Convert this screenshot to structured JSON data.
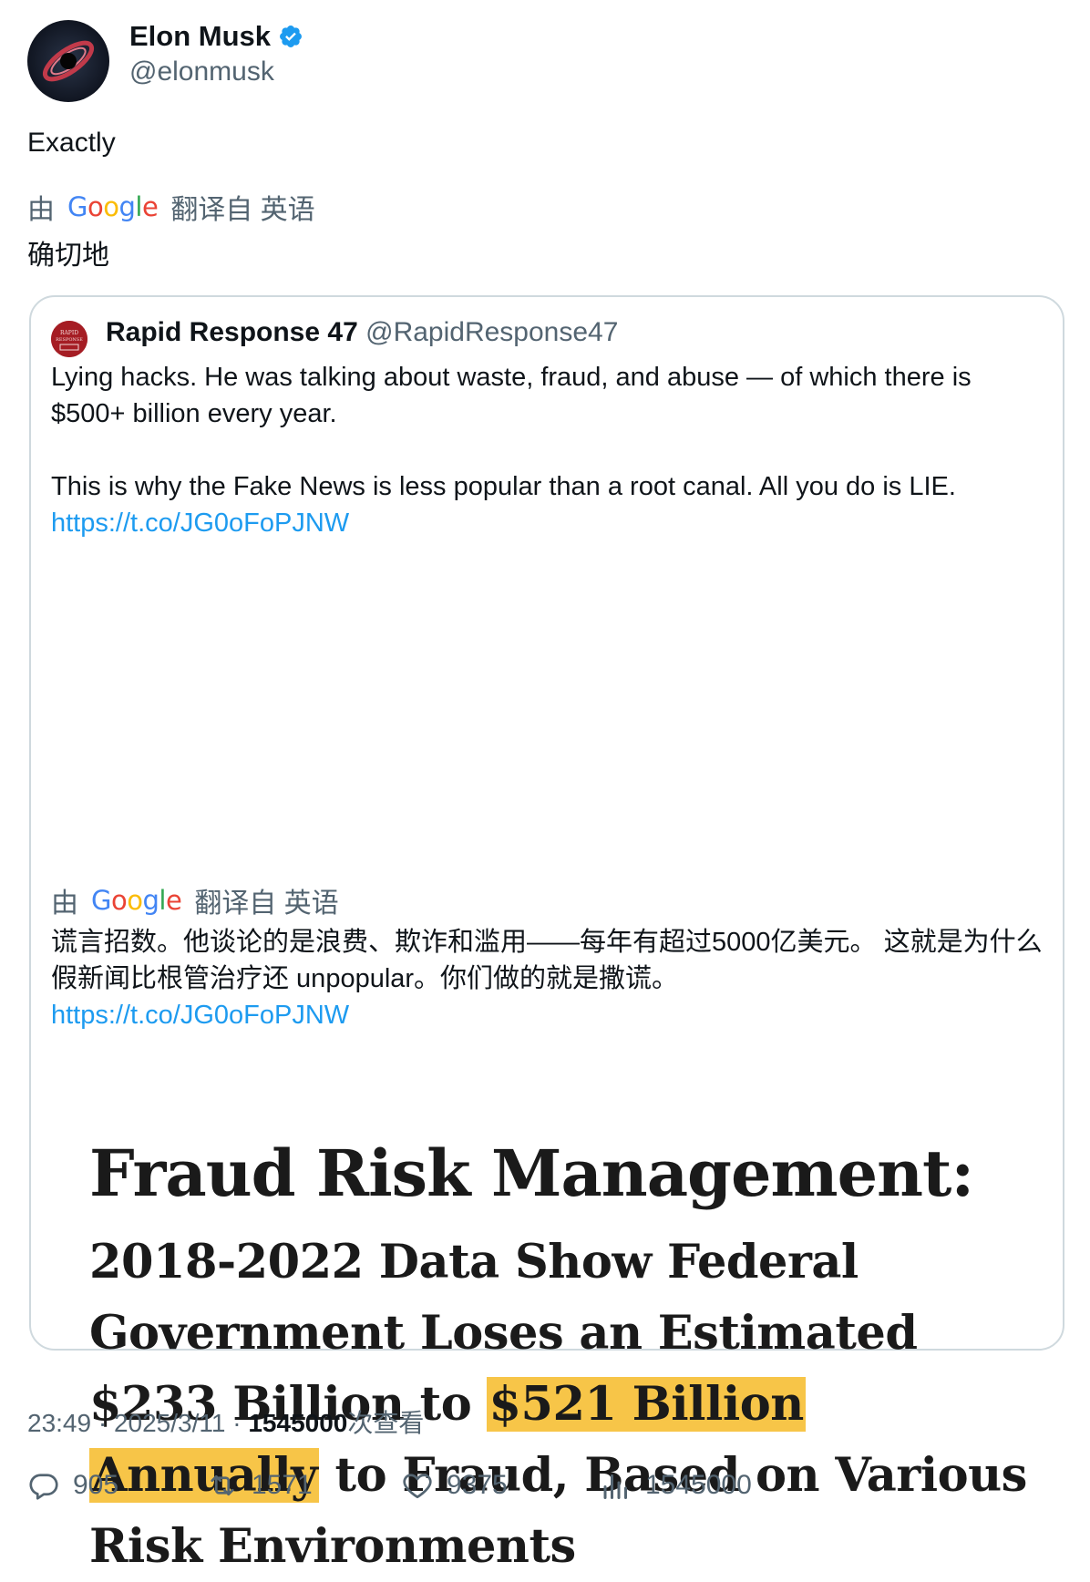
{
  "author": {
    "name": "Elon Musk",
    "handle": "@elonmusk",
    "verified": true
  },
  "tweet": {
    "text": "Exactly",
    "translation_prefix": "由",
    "translation_brand": "Google",
    "translation_suffix": "翻译自 英语",
    "translated_text": "确切地"
  },
  "quote": {
    "name": "Rapid Response 47",
    "handle": "@RapidResponse47",
    "line1": "Lying hacks. He was talking about waste, fraud, and abuse — of which there is $500+ billion every year.",
    "line2": "This is why the Fake News is less popular than a root canal. All you do is LIE.",
    "link": "https://t.co/JG0oFoPJNW",
    "translation_prefix": "由",
    "translation_brand": "Google",
    "translation_suffix": "翻译自 英语",
    "translated_text": "谎言招数。他谈论的是浪费、欺诈和滥用——每年有超过5000亿美元。 这就是为什么假新闻比根管治疗还 unpopular。你们做的就是撒谎。",
    "translated_link": "https://t.co/JG0oFoPJNW",
    "image": {
      "title": "Fraud Risk Management:",
      "sub_part1": "2018-2022 Data Show Federal Government Loses an Estimated $233 Billion to ",
      "highlight1": "$521 Billion",
      "highlight2": "Annually",
      "sub_part2": " to Fraud, Based on Various Risk Environments",
      "highlight_color": "#f7c548"
    }
  },
  "meta": {
    "time": "23:49",
    "sep1": " · ",
    "date": "2025/3/11",
    "sep2": " · ",
    "views": "1545000",
    "views_label": "次查看"
  },
  "stats": {
    "replies": "905",
    "retweets": "1571",
    "likes": "9375",
    "views": "1545000"
  },
  "colors": {
    "link": "#1d9bf0",
    "verified": "#1d9bf0",
    "muted": "#536471"
  }
}
